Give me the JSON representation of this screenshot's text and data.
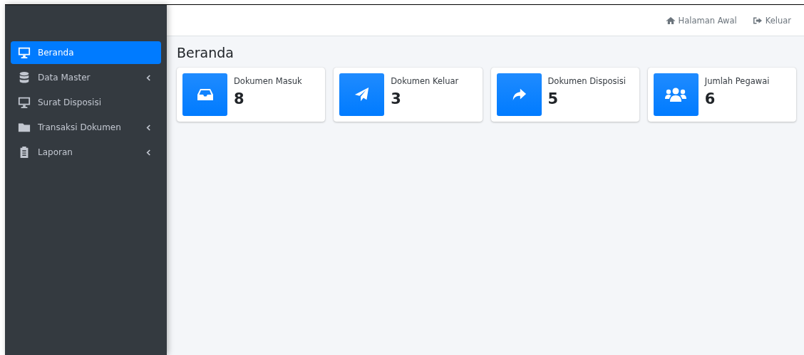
{
  "navbar": {
    "links": [
      {
        "kind": "home",
        "label": "Halaman Awal"
      },
      {
        "kind": "logout",
        "label": "Keluar"
      }
    ]
  },
  "sidebar": {
    "items": [
      {
        "kind": "monitor",
        "label": "Beranda",
        "selected": true,
        "has_submenu": false
      },
      {
        "kind": "database",
        "label": "Data Master",
        "selected": false,
        "has_submenu": true
      },
      {
        "kind": "monitor",
        "label": "Surat Disposisi",
        "selected": false,
        "has_submenu": false
      },
      {
        "kind": "folder",
        "label": "Transaksi Dokumen",
        "selected": false,
        "has_submenu": true
      },
      {
        "kind": "clipboard",
        "label": "Laporan",
        "selected": false,
        "has_submenu": true
      }
    ]
  },
  "page_title": "Beranda",
  "cards": [
    {
      "kind": "inbox",
      "label": "Dokumen Masuk",
      "value": "8"
    },
    {
      "kind": "send",
      "label": "Dokumen Keluar",
      "value": "3"
    },
    {
      "kind": "share",
      "label": "Dokumen Disposisi",
      "value": "5"
    },
    {
      "kind": "users",
      "label": "Jumlah Pegawai",
      "value": "6"
    }
  ]
}
